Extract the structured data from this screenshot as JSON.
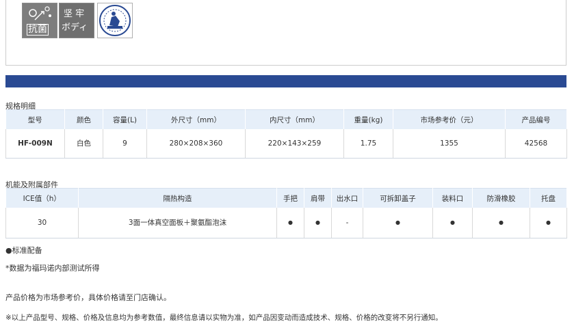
{
  "badges": [
    {
      "name": "antibacterial",
      "text": "抗菌"
    },
    {
      "name": "sturdy-body",
      "line1": "坚 牢",
      "line2": "ボディ"
    },
    {
      "name": "certification-seal"
    }
  ],
  "spec_section": {
    "title": "规格明细",
    "headers": [
      "型号",
      "颜色",
      "容量(L)",
      "外尺寸（mm）",
      "内尺寸（mm）",
      "重量(kg)",
      "市场参考价（元）",
      "产品编号"
    ],
    "row": [
      "HF-009N",
      "白色",
      "9",
      "280×208×360",
      "220×143×259",
      "1.75",
      "1355",
      "42568"
    ]
  },
  "features_section": {
    "title": "机能及附属部件",
    "headers": [
      "ICE值（h）",
      "隔热构造",
      "手把",
      "肩带",
      "出水口",
      "可拆卸盖子",
      "装料口",
      "防滑橡胶",
      "托盘"
    ],
    "row": [
      "30",
      "3面一体真空面板＋聚氨酯泡沫",
      "●",
      "●",
      "-",
      "●",
      "●",
      "●",
      "●"
    ]
  },
  "notes": {
    "standard": "●标准配备",
    "data_note": "*数据为福玛诺内部测试所得",
    "price_note": "产品价格为市场参考价，具体价格请至门店确认。",
    "disclaimer": "※以上产品型号、规格、价格及信息均为参考数值，最终信息请以实物为准，如产品因变动而造成技术、规格、价格的改变将不另行通知。"
  },
  "colors": {
    "accent_bar": "#2a4a93",
    "table_header_bg": "#e6eff9"
  }
}
